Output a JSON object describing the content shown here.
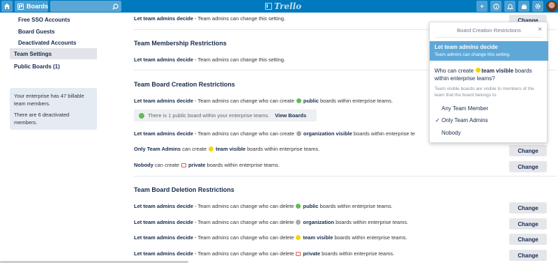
{
  "topbar": {
    "boards_label": "Boards",
    "logo_text": "Trello",
    "icons": [
      "home-icon",
      "board-icon",
      "search-icon",
      "plus-icon",
      "info-icon",
      "bell-icon",
      "bag-icon",
      "gear-icon",
      "avatar"
    ]
  },
  "sidebar": {
    "items": [
      "Free SSO Accounts",
      "Board Guests",
      "Deactivated Accounts",
      "Team Settings",
      "Public Boards (1)"
    ],
    "info_1": "Your enterprise has 47 billable team members.",
    "info_2": "There are 6 deactivated members."
  },
  "main": {
    "top_row": {
      "bold": "Let team admins decide",
      "text": " - Team admins can change this setting."
    },
    "change_label": "Change",
    "membership": {
      "heading": "Team Membership Restrictions",
      "row": {
        "bold": "Let team admins decide",
        "text": " - Team admins can change this setting."
      }
    },
    "creation": {
      "heading": "Team Board Creation Restrictions",
      "row1": {
        "bold": "Let team admins decide",
        "pre": " - Team admins can change who can create ",
        "kind": "public",
        "post": " boards within enterprise teams."
      },
      "notice_text": "There is 1 public board within your enterprise teams.",
      "notice_link": "View Boards",
      "row2": {
        "bold": "Let team admins decide",
        "pre": " - Team admins can change who can create ",
        "kind": "organization visible",
        "post": " boards within enterprise te"
      },
      "row3": {
        "bold": "Only Team Admins",
        "pre": " can create ",
        "kind": "team visible",
        "post": " boards within enterprise teams."
      },
      "row4": {
        "bold": "Nobody",
        "pre": " can create ",
        "kind": "private",
        "post": " boards within enterprise teams."
      }
    },
    "deletion": {
      "heading": "Team Board Deletion Restrictions",
      "row1": {
        "bold": "Let team admins decide",
        "pre": " - Team admins can change who can delete ",
        "kind": "public",
        "post": " boards within enterprise teams."
      },
      "row2": {
        "bold": "Let team admins decide",
        "pre": " - Team admins can change who can delete ",
        "kind": "organization",
        "post": " boards within enterprise teams."
      },
      "row3": {
        "bold": "Let team admins decide",
        "pre": " - Team admins can change who can delete ",
        "kind": "team visible",
        "post": " boards within enterprise teams."
      },
      "row4": {
        "bold": "Let team admins decide",
        "pre": " - Team admins can change who can delete ",
        "kind": "private",
        "post": " boards within enterprise teams."
      }
    }
  },
  "popover": {
    "title": "Board Creation Restrictions",
    "close": "×",
    "selected_title": "Let team admins decide",
    "selected_sub": "Team admins can change this setting.",
    "question_pre": "Who can create ",
    "question_kind": "team visible",
    "question_post": " boards within enterprise teams?",
    "note": "Team visible boards are visible to members of the team that the board belongs to.",
    "options": [
      "Any Team Member",
      "Only Team Admins",
      "Nobody"
    ],
    "checked_index": 1,
    "check_glyph": "✓"
  },
  "colors": {
    "nav": "#0079bf",
    "popover_selected": "#5ea8d8"
  }
}
